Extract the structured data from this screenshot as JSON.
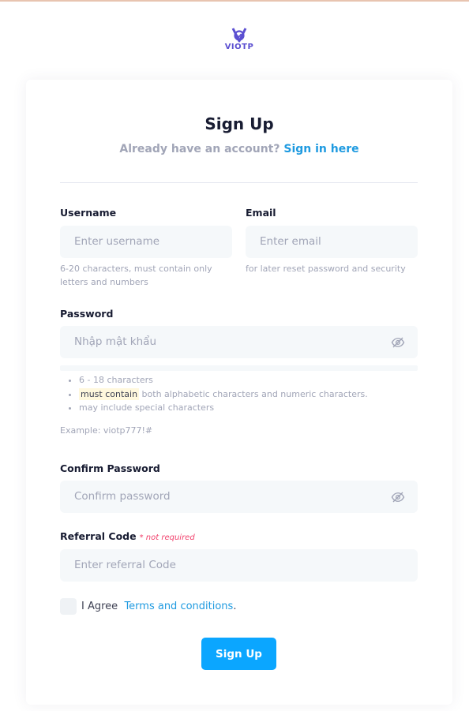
{
  "brand": {
    "name": "VIOTP"
  },
  "header": {
    "title": "Sign Up",
    "subtitle_prefix": "Already have an account?",
    "signin_link": "Sign in here"
  },
  "form": {
    "username": {
      "label": "Username",
      "placeholder": "Enter username",
      "hint": "6-20 characters, must contain only letters and numbers"
    },
    "email": {
      "label": "Email",
      "placeholder": "Enter email",
      "hint": "for later reset password and security"
    },
    "password": {
      "label": "Password",
      "placeholder": "Nhập mật khẩu",
      "rules": [
        {
          "text": "6 - 18 characters"
        },
        {
          "highlight": "must contain",
          "text": " both alphabetic characters and numeric characters."
        },
        {
          "text": "may include special characters"
        }
      ],
      "example": "Example: viotp777!#"
    },
    "confirm_password": {
      "label": "Confirm Password",
      "placeholder": "Confirm password"
    },
    "referral": {
      "label": "Referral Code",
      "optional_note": "* not required",
      "placeholder": "Enter referral Code"
    },
    "agree": {
      "prefix": "I Agree",
      "link": "Terms and conditions",
      "suffix": "."
    },
    "submit_label": "Sign Up"
  },
  "colors": {
    "accent": "#0ba6ff",
    "link": "#1e9ae0",
    "brand": "#5b4fd1",
    "input_bg": "#f5f8fa",
    "optional_note": "#f1416c"
  },
  "icons": {
    "logo": "viotp-logo",
    "password_toggle": "eye-slash-icon",
    "confirm_toggle": "eye-slash-icon"
  }
}
